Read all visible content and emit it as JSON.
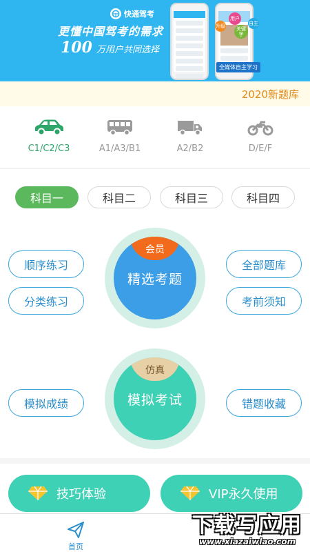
{
  "banner": {
    "brand": "快通驾考",
    "slogan": "更懂中国驾考的需求",
    "users_number": "100",
    "users_text": "万用户共同选择",
    "bubble1": "升级",
    "bubble2": "用户",
    "bubble3": "关键字",
    "bubble4": "自主",
    "tag": "全媒体自主学习",
    "background_color": "#2fb5f0"
  },
  "new_bank": "2020新题库",
  "vehicles": [
    {
      "label": "C1/C2/C3",
      "icon": "car-icon",
      "active": true
    },
    {
      "label": "A1/A3/B1",
      "icon": "bus-icon",
      "active": false
    },
    {
      "label": "A2/B2",
      "icon": "truck-icon",
      "active": false
    },
    {
      "label": "D/E/F",
      "icon": "motorcycle-icon",
      "active": false
    }
  ],
  "subjects": [
    {
      "label": "科目一",
      "active": true
    },
    {
      "label": "科目二",
      "active": false
    },
    {
      "label": "科目三",
      "active": false
    },
    {
      "label": "科目四",
      "active": false
    }
  ],
  "practice": {
    "sequential": "顺序练习",
    "category": "分类练习",
    "all_questions": "全部题库",
    "exam_notes": "考前须知",
    "featured_badge": "会员",
    "featured": "精选考题",
    "mock_score": "模拟成绩",
    "wrong_collection": "错题收藏",
    "mock_badge": "仿真",
    "mock_exam": "模拟考试"
  },
  "actions": {
    "tips": "技巧体验",
    "vip": "VIP永久使用"
  },
  "tabbar": {
    "home": "首页"
  },
  "watermark": {
    "main": "下载写应用",
    "sub": "www.xiazaiwlao.com"
  },
  "colors": {
    "accent_green": "#5cb85c",
    "pill_blue": "#3aa6dd",
    "featured_blue": "#3b9ee6",
    "mock_teal": "#3fd1b5",
    "badge_orange": "#f26b1d",
    "badge_tan": "#e7cfa6"
  }
}
